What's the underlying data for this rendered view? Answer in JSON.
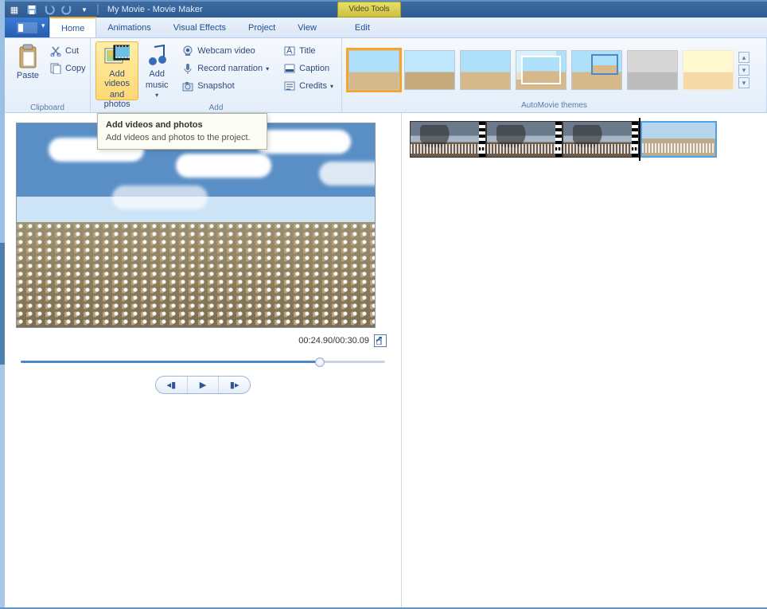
{
  "titlebar": {
    "title": "My Movie - Movie Maker",
    "tools_tab": "Video Tools"
  },
  "tabs": {
    "home": "Home",
    "animations": "Animations",
    "visual": "Visual Effects",
    "project": "Project",
    "view": "View",
    "edit": "Edit"
  },
  "ribbon": {
    "clipboard": {
      "paste": "Paste",
      "cut": "Cut",
      "copy": "Copy",
      "group": "Clipboard"
    },
    "add": {
      "addvp_line1": "Add videos",
      "addvp_line2": "and photos",
      "addmusic_line1": "Add",
      "addmusic_line2": "music",
      "dd": "▾",
      "webcam": "Webcam video",
      "record": "Record narration",
      "snapshot": "Snapshot",
      "title": "Title",
      "caption": "Caption",
      "credits": "Credits",
      "group": "Add"
    },
    "themes": {
      "group": "AutoMovie themes"
    }
  },
  "tooltip": {
    "title": "Add videos and photos",
    "body": "Add videos and photos to the project."
  },
  "player": {
    "time": "00:24.90/00:30.09",
    "prev": "◂▮",
    "play": "▶",
    "next": "▮▸"
  },
  "slider": {
    "percent": 82
  }
}
